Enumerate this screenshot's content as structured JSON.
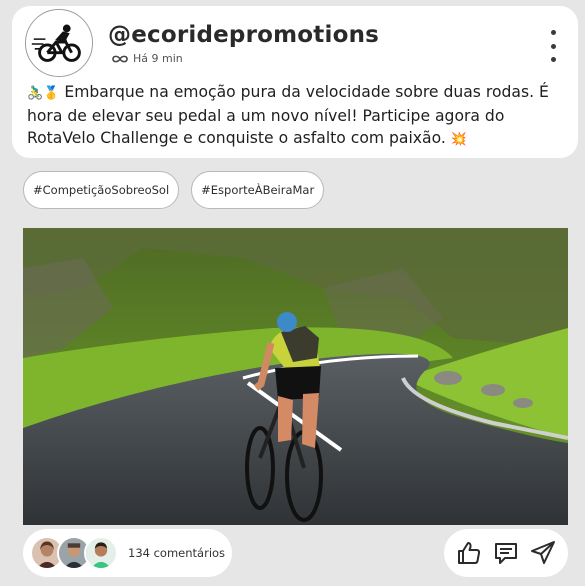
{
  "post": {
    "handle": "@ecoridepromotions",
    "time": "Há 9 min",
    "time_icon": "infinity-icon",
    "emoji_lead": "🚴‍♂️🥇",
    "caption": "Embarque na emoção pura da velocidade sobre duas rodas. É hora de elevar seu pedal a um novo nível! Participe agora do RotaVelo Challenge e conquiste o asfalto com paixão.",
    "emoji_tail": "💥"
  },
  "tags": [
    "#CompetiçãoSobreoSol",
    "#EsporteÀBeiraMar"
  ],
  "footer": {
    "comments_label": "134 comentários",
    "actions": [
      "like-icon",
      "comment-icon",
      "share-icon"
    ]
  },
  "colors": {
    "background": "#e6e6e6",
    "card": "#ffffff",
    "text": "#1e1e1e"
  }
}
